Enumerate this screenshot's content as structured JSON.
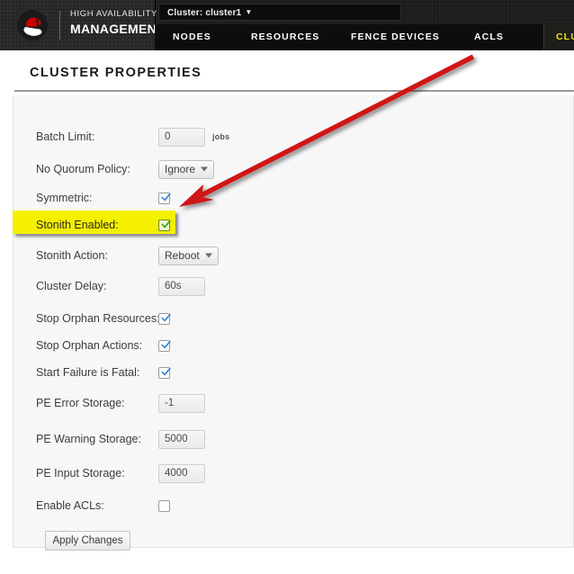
{
  "header": {
    "brand_line1": "HIGH AVAILABILITY",
    "brand_line2": "MANAGEMENT",
    "logo_icon": "redhat-shadowman-logo",
    "cluster_selector_label": "Cluster: cluster1",
    "cluster_selector_caret": "▼",
    "nav_tabs": [
      {
        "label": "NODES",
        "active": false
      },
      {
        "label": "RESOURCES",
        "active": false
      },
      {
        "label": "FENCE DEVICES",
        "active": false
      },
      {
        "label": "ACLS",
        "active": false
      },
      {
        "label": "CLUSTER PROPERTIES",
        "active": true
      }
    ]
  },
  "page": {
    "title": "CLUSTER PROPERTIES"
  },
  "form": {
    "rows": [
      {
        "label": "Batch Limit:",
        "type": "text",
        "value": "0",
        "unit": "jobs"
      },
      {
        "label": "No Quorum Policy:",
        "type": "select",
        "value": "Ignore"
      },
      {
        "label": "Symmetric:",
        "type": "checkbox",
        "checked": true,
        "style": "blue"
      },
      {
        "label": "Stonith Enabled:",
        "type": "checkbox",
        "checked": true,
        "style": "green",
        "highlighted": true
      },
      {
        "label": "Stonith Action:",
        "type": "select",
        "value": "Reboot"
      },
      {
        "label": "Cluster Delay:",
        "type": "text",
        "value": "60s"
      },
      {
        "label": "Stop Orphan Resources:",
        "type": "checkbox",
        "checked": true,
        "style": "blue"
      },
      {
        "label": "Stop Orphan Actions:",
        "type": "checkbox",
        "checked": true,
        "style": "blue"
      },
      {
        "label": "Start Failure is Fatal:",
        "type": "checkbox",
        "checked": true,
        "style": "blue"
      },
      {
        "label": "PE Error Storage:",
        "type": "text",
        "value": "-1"
      },
      {
        "label": "PE Warning Storage:",
        "type": "text",
        "value": "5000"
      },
      {
        "label": "PE Input Storage:",
        "type": "text",
        "value": "4000"
      },
      {
        "label": "Enable ACLs:",
        "type": "checkbox",
        "checked": false,
        "style": "blue"
      }
    ],
    "apply_label": "Apply Changes"
  },
  "annotation": {
    "arrow_icon": "red-pointer-arrow",
    "arrow_color": "#d11717"
  },
  "colors": {
    "highlight": "#f5f000",
    "active_tab_text": "#f3e500",
    "topbar": "#1c1c1c",
    "panel": "#f7f7f7"
  }
}
